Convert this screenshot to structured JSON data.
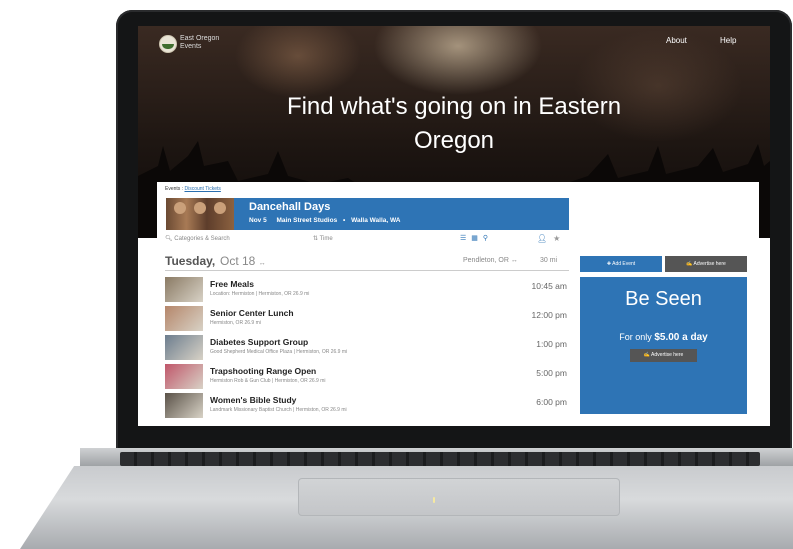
{
  "header": {
    "logo_line1": "East Oregon",
    "logo_line2": "Events",
    "nav": {
      "about": "About",
      "help": "Help"
    },
    "hero_line1": "Find what's going on in Eastern",
    "hero_line2": "Oregon"
  },
  "breadcrumb": {
    "prefix": "Events :",
    "link": "Discount Tickets"
  },
  "featured": {
    "title": "Dancehall Days",
    "date": "Nov 5",
    "venue": "Main Street Studios",
    "location": "Walla Walla, WA"
  },
  "filters": {
    "search_placeholder": "Categories & Search",
    "time_label": "Time"
  },
  "day": {
    "name": "Tuesday,",
    "date": "Oct 18",
    "location": "Pendleton, OR",
    "distance": "30 mi"
  },
  "events": [
    {
      "title": "Free Meals",
      "meta": "Location: Hermiston | Hermiston, OR   26.9 mi",
      "time": "10:45 am",
      "thumb_color": "#8a7a64"
    },
    {
      "title": "Senior Center Lunch",
      "meta": "Hermiston, OR   26.9 mi",
      "time": "12:00 pm",
      "thumb_color": "#b5866a"
    },
    {
      "title": "Diabetes Support Group",
      "meta": "Good Shepherd Medical Office Plaza | Hermiston, OR   26.9 mi",
      "time": "1:00 pm",
      "thumb_color": "#6c7d8e"
    },
    {
      "title": "Trapshooting Range Open",
      "meta": "Hermiston Rob & Gun Club | Hermiston, OR   26.9 mi",
      "time": "5:00 pm",
      "thumb_color": "#c0566a"
    },
    {
      "title": "Women's Bible Study",
      "meta": "Landmark Missionary Baptist Church | Hermiston, OR   26.9 mi",
      "time": "6:00 pm",
      "thumb_color": "#5a5248"
    }
  ],
  "sidebar": {
    "add_event": "✚ Add Event",
    "advertise": "✍ Advertise here",
    "ad_title": "Be Seen",
    "ad_price_prefix": "For only",
    "ad_price": "$5.00 a day",
    "ad_button": "✍ Advertise here"
  },
  "colors": {
    "accent": "#2e74b5",
    "dark_button": "#555555"
  }
}
